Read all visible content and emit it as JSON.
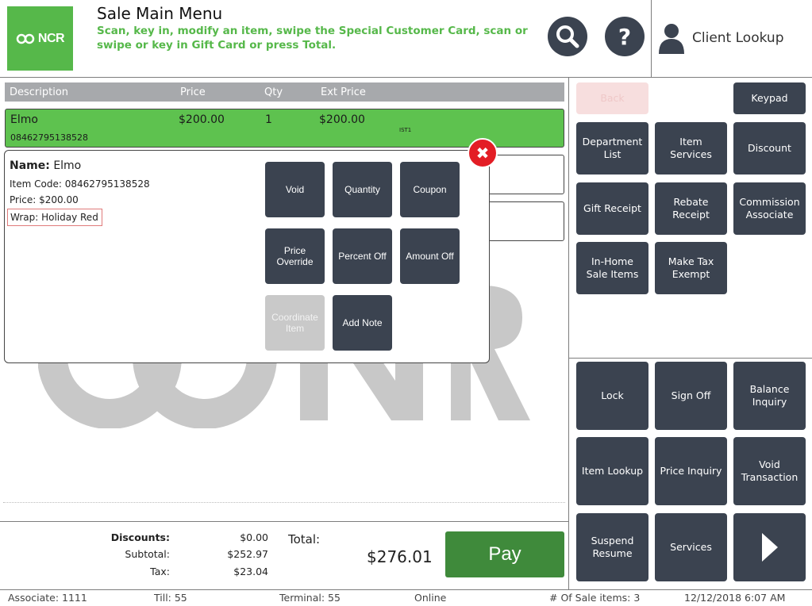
{
  "header": {
    "logo_text": "NCR",
    "title": "Sale Main Menu",
    "subtitle": "Scan, key in, modify an item, swipe the Special Customer Card, scan or swipe or key in Gift Card or press Total.",
    "help_label": "?",
    "client_lookup_label": "Client Lookup"
  },
  "table": {
    "headers": {
      "description": "Description",
      "price": "Price",
      "qty": "Qty",
      "ext_price": "Ext Price"
    },
    "items": [
      {
        "description": "Elmo",
        "code": "08462795138528",
        "price": "$200.00",
        "qty": "1",
        "ext_price": "$200.00",
        "tax_code": "IST1"
      }
    ]
  },
  "popup": {
    "name_label": "Name:",
    "name_value": "Elmo",
    "item_code": "Item Code: 08462795138528",
    "price": "Price: $200.00",
    "wrap": "Wrap: Holiday Red",
    "close_glyph": "✖",
    "buttons": {
      "void": "Void",
      "quantity": "Quantity",
      "coupon": "Coupon",
      "price_override": "Price Override",
      "percent_off": "Percent Off",
      "amount_off": "Amount Off",
      "coordinate_item": "Coordinate Item",
      "add_note": "Add Note"
    }
  },
  "right_panel": {
    "back": "Back",
    "keypad": "Keypad",
    "department_list": "Department List",
    "item_services": "Item Services",
    "discount": "Discount",
    "gift_receipt": "Gift Receipt",
    "rebate_receipt": "Rebate Receipt",
    "commission_associate": "Commission Associate",
    "in_home_sale_items": "In-Home Sale Items",
    "make_tax_exempt": "Make Tax Exempt",
    "lock": "Lock",
    "sign_off": "Sign Off",
    "balance_inquiry": "Balance Inquiry",
    "item_lookup": "Item Lookup",
    "price_inquiry": "Price Inquiry",
    "void_transaction": "Void Transaction",
    "suspend_resume": "Suspend Resume",
    "services": "Services"
  },
  "totals": {
    "discounts_label": "Discounts:",
    "discounts_value": "$0.00",
    "subtotal_label": "Subtotal:",
    "subtotal_value": "$252.97",
    "tax_label": "Tax:",
    "tax_value": "$23.04",
    "total_label": "Total:",
    "total_value": "$276.01",
    "pay_label": "Pay"
  },
  "status_bar": {
    "associate": "Associate: 1111",
    "till": "Till: 55",
    "terminal": "Terminal: 55",
    "online": "Online",
    "sale_items": "# Of Sale items: 3",
    "datetime": "12/12/2018 6:07 AM"
  },
  "colors": {
    "brand_green": "#56b84a",
    "button_dark": "#3b4350",
    "pay_green": "#3f8a3b",
    "close_red": "#e31d25",
    "selected_row": "#5ec24f"
  }
}
